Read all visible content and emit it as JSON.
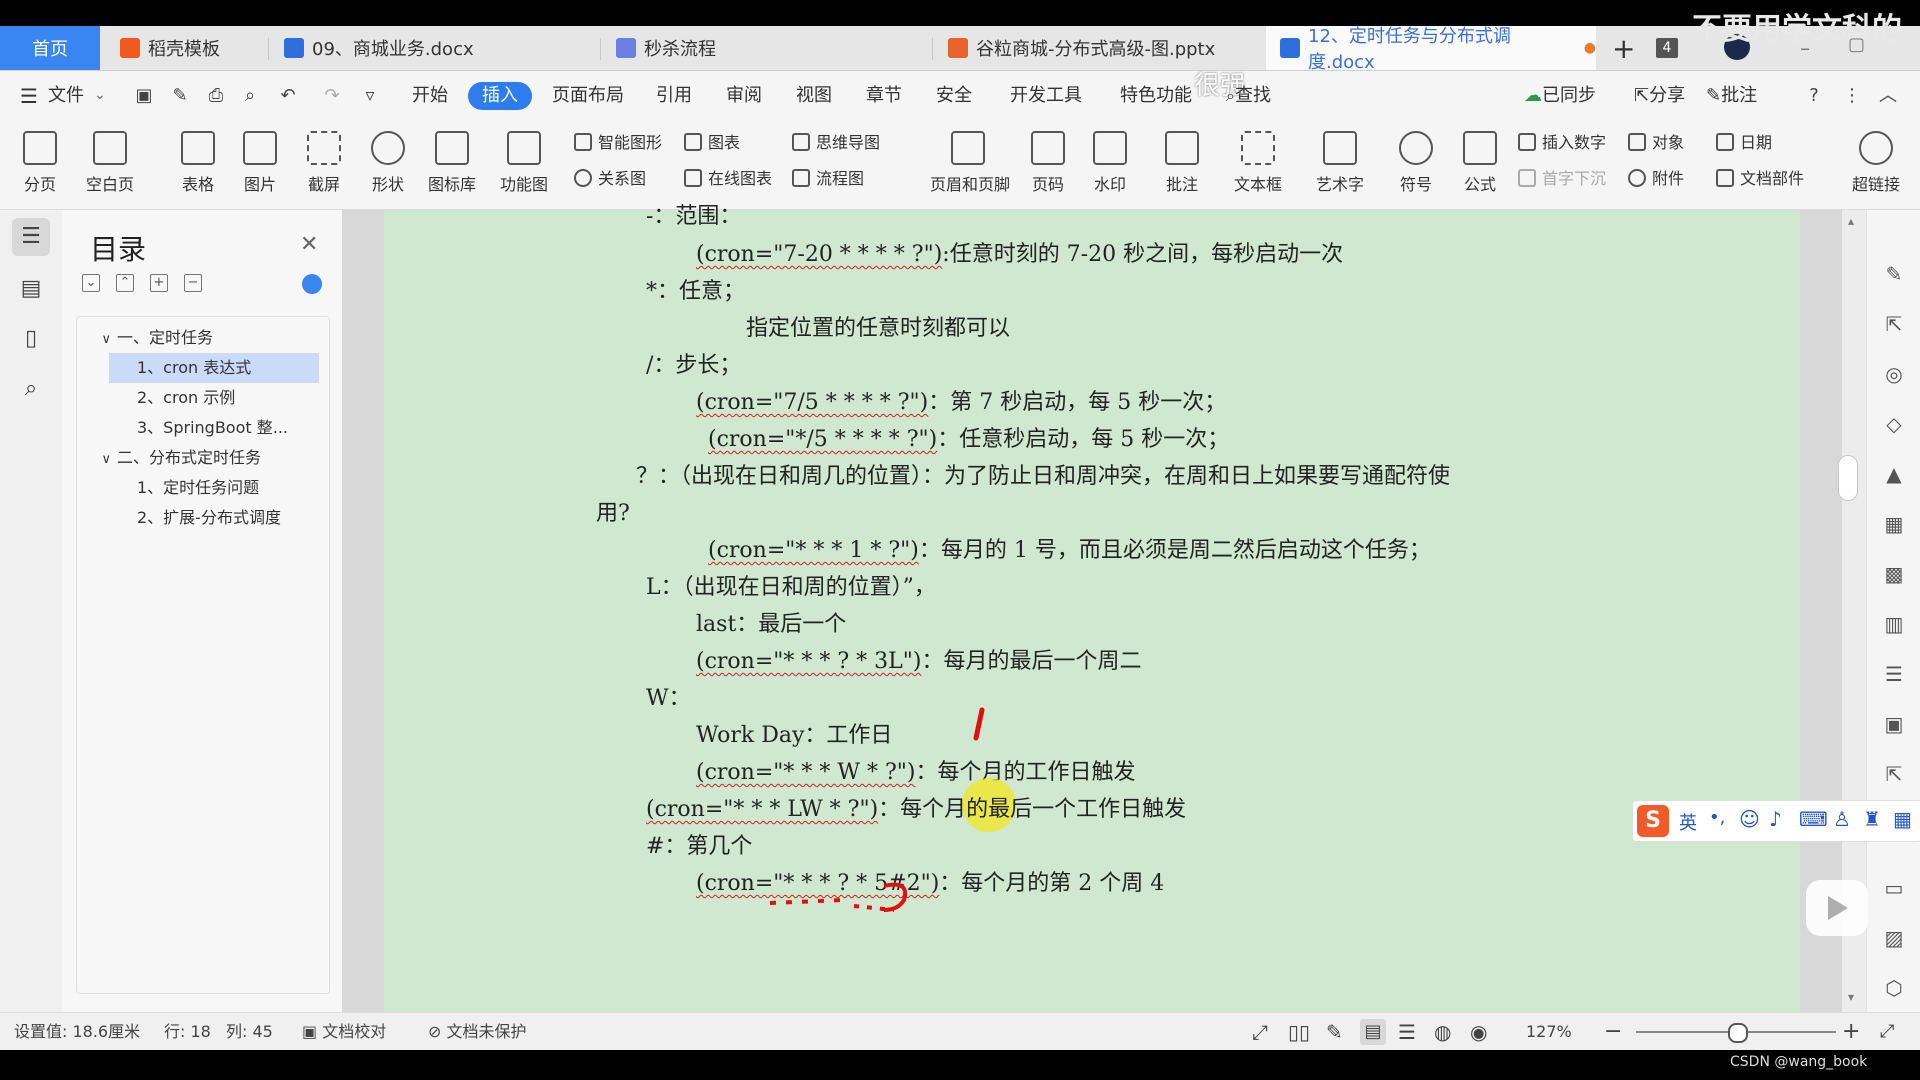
{
  "tabs": [
    {
      "label": "首页",
      "color": "#3a86f0"
    },
    {
      "label": "稻壳模板",
      "color": "#f05a1e"
    },
    {
      "label": "09、商城业务.docx",
      "color": "#2f6fdd"
    },
    {
      "label": "秒杀流程",
      "color": "#6a7fe0"
    },
    {
      "label": "谷粒商城-分布式高级-图.pptx",
      "color": "#e8632a"
    },
    {
      "label": "12、定时任务与分布式调度.docx",
      "color": "#2f6fdd"
    }
  ],
  "tab_count": "4",
  "watermark": "不要用学文科的",
  "menus": {
    "file": "文件",
    "items": [
      "开始",
      "插入",
      "页面布局",
      "引用",
      "审阅",
      "视图",
      "章节",
      "安全",
      "开发工具",
      "特色功能"
    ],
    "active": "插入",
    "search": "查找",
    "synced": "已同步",
    "share": "分享",
    "annotate": "批注"
  },
  "ribbon": {
    "big": [
      "分页",
      "空白页",
      "表格",
      "图片",
      "截屏",
      "形状",
      "图标库",
      "功能图"
    ],
    "small_col1": [
      "智能图形",
      "关系图"
    ],
    "small_col2": [
      "图表",
      "在线图表"
    ],
    "small_col3": [
      "思维导图",
      "流程图"
    ],
    "big2": [
      "页眉和页脚",
      "页码",
      "水印",
      "批注",
      "文本框",
      "艺术字",
      "符号",
      "公式"
    ],
    "small_col4": [
      "插入数字",
      "首字下沉"
    ],
    "small_col5": [
      "对象",
      "附件"
    ],
    "small_col6": [
      "日期",
      "文档部件"
    ],
    "hyperlink": "超链接"
  },
  "toc": {
    "title": "目录",
    "items": [
      {
        "label": "一、定时任务",
        "level": 0,
        "expanded": true
      },
      {
        "label": "1、cron 表达式",
        "level": 1,
        "selected": true
      },
      {
        "label": "2、cron 示例",
        "level": 1
      },
      {
        "label": "3、SpringBoot 整...",
        "level": 1
      },
      {
        "label": "二、分布式定时任务",
        "level": 0,
        "expanded": true
      },
      {
        "label": "1、定时任务问题",
        "level": 1
      },
      {
        "label": "2、扩展-分布式调度",
        "level": 1
      }
    ]
  },
  "overlay_text": "很强",
  "doc": {
    "l01": "-：范围：",
    "l02a": "(cron=\"7-20 * * * * ?\")",
    "l02b": ":任意时刻的 7-20 秒之间，每秒启动一次",
    "l03": "*：任意；",
    "l04": "指定位置的任意时刻都可以",
    "l05": "/：步长；",
    "l06a": "(cron=\"7/5 * * * * ?\")",
    "l06b": "：第 7 秒启动，每 5 秒一次；",
    "l07a": "(cron=\"*/5 * * * * ?\")",
    "l07b": "：任意秒启动，每 5 秒一次；",
    "l08": "？：（出现在日和周几的位置）：为了防止日和周冲突，在周和日上如果要写通配符使",
    "l09": "用?",
    "l10a": "(cron=\"* * * 1 * ?\")",
    "l10b": "：每月的 1 号，而且必须是周二然后启动这个任务；",
    "l11": "L：（出现在日和周的位置）”，",
    "l12": "last：最后一个",
    "l13a": "(cron=\"* * * ? * 3L\")",
    "l13b": "：每月的最后一个周二",
    "l14": "W：",
    "l15": "Work Day：工作日",
    "l16a": "(cron=\"* * * W * ?\")",
    "l16b": "：每个月的工作日触发",
    "l17a": "(cron=\"* * * LW * ?\")",
    "l17b": "：每个月的最后一个工作日触发",
    "l18": "#：第几个",
    "l19a": "(cron=\"* * * ? * 5#2\")",
    "l19b": "：每个月的第 2 个周 4"
  },
  "status": {
    "setting": "设置值: 18.6厘米",
    "row": "行: 18",
    "col": "列: 45",
    "proof": "文档校对",
    "protect": "文档未保护",
    "zoom": "127%",
    "credit": "CSDN @wang_book"
  },
  "ime": {
    "lang": "英"
  }
}
